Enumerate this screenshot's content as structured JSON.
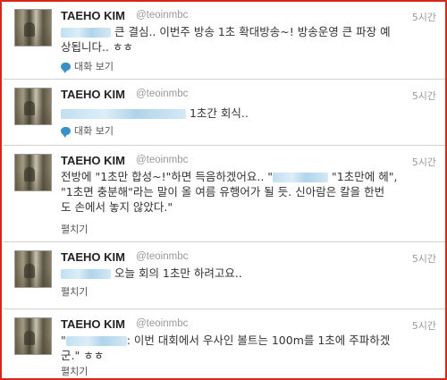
{
  "tweets": [
    {
      "name": "TAEHO KIM",
      "handle": "@teoinmbc",
      "time": "5시간",
      "line1": "큰 결심.. 이번주 방송 1초 확대방송~! 방송운영 큰 파장 예",
      "line2": "상됩니다.. ㅎㅎ",
      "action": "대화 보기"
    },
    {
      "name": "TAEHO KIM",
      "handle": "@teoinmbc",
      "time": "5시간",
      "line1": "1초간 회식..",
      "action": "대화 보기"
    },
    {
      "name": "TAEHO KIM",
      "handle": "@teoinmbc",
      "time": "5시간",
      "line1a": "전방에 \"1초만 합성~!\"하면 득음하겠어요.. \"",
      "line1b": "\"1초만에 헤\",",
      "line2": "\"1초면 충분해\"라는 말이 올 여름 유행어가 될 듯. 신아람은 칼을 한번",
      "line3": "도 손에서 놓지 않았다.\"",
      "action": "펼치기"
    },
    {
      "name": "TAEHO KIM",
      "handle": "@teoinmbc",
      "time": "5시간",
      "line1": "오늘 회의 1초만 하려고요..",
      "action": "펼치기"
    },
    {
      "name": "TAEHO KIM",
      "handle": "@teoinmbc",
      "time": "5시간",
      "line1a": "\"",
      "line1b": ": 이번 대회에서 우사인 볼트는 100m를 1초에 주파하겠",
      "line2": "군.\" ㅎㅎ",
      "action": "펼치기"
    }
  ],
  "icons": {
    "conversation": "speech-bubble-icon"
  },
  "colors": {
    "frame_border": "#d9261c",
    "name": "#222222",
    "meta": "#999999",
    "icon_blue": "#3b8fc4"
  }
}
